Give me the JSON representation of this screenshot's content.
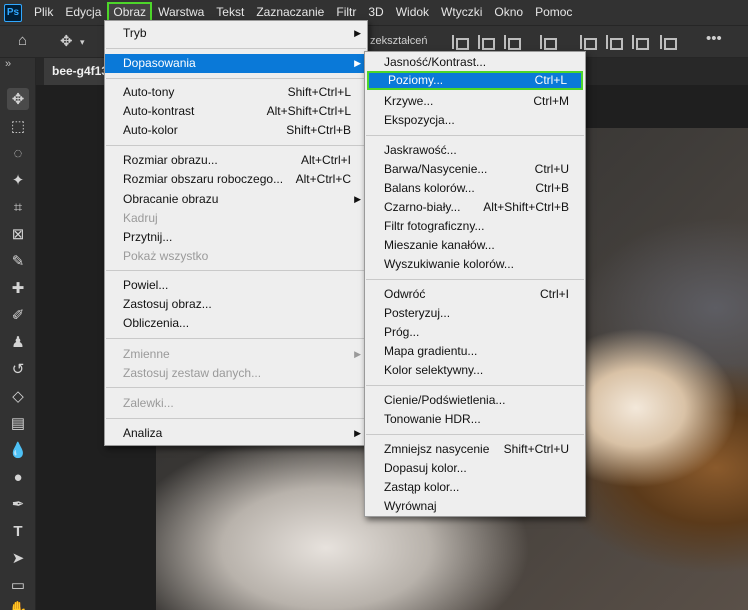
{
  "menubar": {
    "logo": "Ps",
    "items": [
      "Plik",
      "Edycja",
      "Obraz",
      "Warstwa",
      "Tekst",
      "Zaznaczanie",
      "Filtr",
      "3D",
      "Widok",
      "Wtyczki",
      "Okno",
      "Pomoc"
    ],
    "active_index": 2
  },
  "optionsbar": {
    "partial_text": "zekształceń"
  },
  "document_tab": {
    "label": "bee-g4f13"
  },
  "image_menu": {
    "items": [
      {
        "label": "Tryb",
        "shortcut": "",
        "submenu": true,
        "disabled": false
      },
      {
        "label": "Dopasowania",
        "shortcut": "",
        "submenu": true,
        "disabled": false,
        "highlighted": true
      },
      {
        "label": "Auto-tony",
        "shortcut": "Shift+Ctrl+L",
        "submenu": false,
        "disabled": false
      },
      {
        "label": "Auto-kontrast",
        "shortcut": "Alt+Shift+Ctrl+L",
        "submenu": false,
        "disabled": false
      },
      {
        "label": "Auto-kolor",
        "shortcut": "Shift+Ctrl+B",
        "submenu": false,
        "disabled": false
      },
      {
        "label": "Rozmiar obrazu...",
        "shortcut": "Alt+Ctrl+I",
        "submenu": false,
        "disabled": false
      },
      {
        "label": "Rozmiar obszaru roboczego...",
        "shortcut": "Alt+Ctrl+C",
        "submenu": false,
        "disabled": false
      },
      {
        "label": "Obracanie obrazu",
        "shortcut": "",
        "submenu": true,
        "disabled": false
      },
      {
        "label": "Kadruj",
        "shortcut": "",
        "submenu": false,
        "disabled": true
      },
      {
        "label": "Przytnij...",
        "shortcut": "",
        "submenu": false,
        "disabled": false
      },
      {
        "label": "Pokaż wszystko",
        "shortcut": "",
        "submenu": false,
        "disabled": true
      },
      {
        "label": "Powiel...",
        "shortcut": "",
        "submenu": false,
        "disabled": false
      },
      {
        "label": "Zastosuj obraz...",
        "shortcut": "",
        "submenu": false,
        "disabled": false
      },
      {
        "label": "Obliczenia...",
        "shortcut": "",
        "submenu": false,
        "disabled": false
      },
      {
        "label": "Zmienne",
        "shortcut": "",
        "submenu": true,
        "disabled": true
      },
      {
        "label": "Zastosuj zestaw danych...",
        "shortcut": "",
        "submenu": false,
        "disabled": true
      },
      {
        "label": "Zalewki...",
        "shortcut": "",
        "submenu": false,
        "disabled": true
      },
      {
        "label": "Analiza",
        "shortcut": "",
        "submenu": true,
        "disabled": false
      }
    ]
  },
  "adjustments_menu": {
    "items": [
      {
        "label": "Jasność/Kontrast...",
        "shortcut": ""
      },
      {
        "label": "Poziomy...",
        "shortcut": "Ctrl+L",
        "highlighted": true
      },
      {
        "label": "Krzywe...",
        "shortcut": "Ctrl+M"
      },
      {
        "label": "Ekspozycja...",
        "shortcut": ""
      },
      {
        "label": "Jaskrawość...",
        "shortcut": ""
      },
      {
        "label": "Barwa/Nasycenie...",
        "shortcut": "Ctrl+U"
      },
      {
        "label": "Balans kolorów...",
        "shortcut": "Ctrl+B"
      },
      {
        "label": "Czarno-biały...",
        "shortcut": "Alt+Shift+Ctrl+B"
      },
      {
        "label": "Filtr fotograficzny...",
        "shortcut": ""
      },
      {
        "label": "Mieszanie kanałów...",
        "shortcut": ""
      },
      {
        "label": "Wyszukiwanie kolorów...",
        "shortcut": ""
      },
      {
        "label": "Odwróć",
        "shortcut": "Ctrl+I"
      },
      {
        "label": "Posteryzuj...",
        "shortcut": ""
      },
      {
        "label": "Próg...",
        "shortcut": ""
      },
      {
        "label": "Mapa gradientu...",
        "shortcut": ""
      },
      {
        "label": "Kolor selektywny...",
        "shortcut": ""
      },
      {
        "label": "Cienie/Podświetlenia...",
        "shortcut": ""
      },
      {
        "label": "Tonowanie HDR...",
        "shortcut": ""
      },
      {
        "label": "Zmniejsz nasycenie",
        "shortcut": "Shift+Ctrl+U"
      },
      {
        "label": "Dopasuj kolor...",
        "shortcut": ""
      },
      {
        "label": "Zastąp kolor...",
        "shortcut": ""
      },
      {
        "label": "Wyrównaj",
        "shortcut": ""
      }
    ]
  },
  "colors": {
    "highlight": "#0a79d8",
    "callout": "#4dd62a"
  }
}
